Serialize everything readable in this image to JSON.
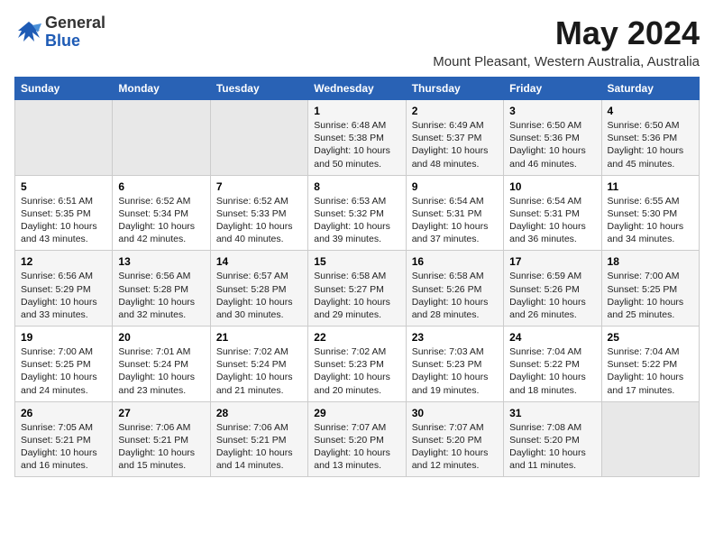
{
  "header": {
    "logo_general": "General",
    "logo_blue": "Blue",
    "title": "May 2024",
    "subtitle": "Mount Pleasant, Western Australia, Australia"
  },
  "calendar": {
    "days_of_week": [
      "Sunday",
      "Monday",
      "Tuesday",
      "Wednesday",
      "Thursday",
      "Friday",
      "Saturday"
    ],
    "weeks": [
      [
        {
          "day": "",
          "info": ""
        },
        {
          "day": "",
          "info": ""
        },
        {
          "day": "",
          "info": ""
        },
        {
          "day": "1",
          "info": "Sunrise: 6:48 AM\nSunset: 5:38 PM\nDaylight: 10 hours\nand 50 minutes."
        },
        {
          "day": "2",
          "info": "Sunrise: 6:49 AM\nSunset: 5:37 PM\nDaylight: 10 hours\nand 48 minutes."
        },
        {
          "day": "3",
          "info": "Sunrise: 6:50 AM\nSunset: 5:36 PM\nDaylight: 10 hours\nand 46 minutes."
        },
        {
          "day": "4",
          "info": "Sunrise: 6:50 AM\nSunset: 5:36 PM\nDaylight: 10 hours\nand 45 minutes."
        }
      ],
      [
        {
          "day": "5",
          "info": "Sunrise: 6:51 AM\nSunset: 5:35 PM\nDaylight: 10 hours\nand 43 minutes."
        },
        {
          "day": "6",
          "info": "Sunrise: 6:52 AM\nSunset: 5:34 PM\nDaylight: 10 hours\nand 42 minutes."
        },
        {
          "day": "7",
          "info": "Sunrise: 6:52 AM\nSunset: 5:33 PM\nDaylight: 10 hours\nand 40 minutes."
        },
        {
          "day": "8",
          "info": "Sunrise: 6:53 AM\nSunset: 5:32 PM\nDaylight: 10 hours\nand 39 minutes."
        },
        {
          "day": "9",
          "info": "Sunrise: 6:54 AM\nSunset: 5:31 PM\nDaylight: 10 hours\nand 37 minutes."
        },
        {
          "day": "10",
          "info": "Sunrise: 6:54 AM\nSunset: 5:31 PM\nDaylight: 10 hours\nand 36 minutes."
        },
        {
          "day": "11",
          "info": "Sunrise: 6:55 AM\nSunset: 5:30 PM\nDaylight: 10 hours\nand 34 minutes."
        }
      ],
      [
        {
          "day": "12",
          "info": "Sunrise: 6:56 AM\nSunset: 5:29 PM\nDaylight: 10 hours\nand 33 minutes."
        },
        {
          "day": "13",
          "info": "Sunrise: 6:56 AM\nSunset: 5:28 PM\nDaylight: 10 hours\nand 32 minutes."
        },
        {
          "day": "14",
          "info": "Sunrise: 6:57 AM\nSunset: 5:28 PM\nDaylight: 10 hours\nand 30 minutes."
        },
        {
          "day": "15",
          "info": "Sunrise: 6:58 AM\nSunset: 5:27 PM\nDaylight: 10 hours\nand 29 minutes."
        },
        {
          "day": "16",
          "info": "Sunrise: 6:58 AM\nSunset: 5:26 PM\nDaylight: 10 hours\nand 28 minutes."
        },
        {
          "day": "17",
          "info": "Sunrise: 6:59 AM\nSunset: 5:26 PM\nDaylight: 10 hours\nand 26 minutes."
        },
        {
          "day": "18",
          "info": "Sunrise: 7:00 AM\nSunset: 5:25 PM\nDaylight: 10 hours\nand 25 minutes."
        }
      ],
      [
        {
          "day": "19",
          "info": "Sunrise: 7:00 AM\nSunset: 5:25 PM\nDaylight: 10 hours\nand 24 minutes."
        },
        {
          "day": "20",
          "info": "Sunrise: 7:01 AM\nSunset: 5:24 PM\nDaylight: 10 hours\nand 23 minutes."
        },
        {
          "day": "21",
          "info": "Sunrise: 7:02 AM\nSunset: 5:24 PM\nDaylight: 10 hours\nand 21 minutes."
        },
        {
          "day": "22",
          "info": "Sunrise: 7:02 AM\nSunset: 5:23 PM\nDaylight: 10 hours\nand 20 minutes."
        },
        {
          "day": "23",
          "info": "Sunrise: 7:03 AM\nSunset: 5:23 PM\nDaylight: 10 hours\nand 19 minutes."
        },
        {
          "day": "24",
          "info": "Sunrise: 7:04 AM\nSunset: 5:22 PM\nDaylight: 10 hours\nand 18 minutes."
        },
        {
          "day": "25",
          "info": "Sunrise: 7:04 AM\nSunset: 5:22 PM\nDaylight: 10 hours\nand 17 minutes."
        }
      ],
      [
        {
          "day": "26",
          "info": "Sunrise: 7:05 AM\nSunset: 5:21 PM\nDaylight: 10 hours\nand 16 minutes."
        },
        {
          "day": "27",
          "info": "Sunrise: 7:06 AM\nSunset: 5:21 PM\nDaylight: 10 hours\nand 15 minutes."
        },
        {
          "day": "28",
          "info": "Sunrise: 7:06 AM\nSunset: 5:21 PM\nDaylight: 10 hours\nand 14 minutes."
        },
        {
          "day": "29",
          "info": "Sunrise: 7:07 AM\nSunset: 5:20 PM\nDaylight: 10 hours\nand 13 minutes."
        },
        {
          "day": "30",
          "info": "Sunrise: 7:07 AM\nSunset: 5:20 PM\nDaylight: 10 hours\nand 12 minutes."
        },
        {
          "day": "31",
          "info": "Sunrise: 7:08 AM\nSunset: 5:20 PM\nDaylight: 10 hours\nand 11 minutes."
        },
        {
          "day": "",
          "info": ""
        }
      ]
    ]
  }
}
